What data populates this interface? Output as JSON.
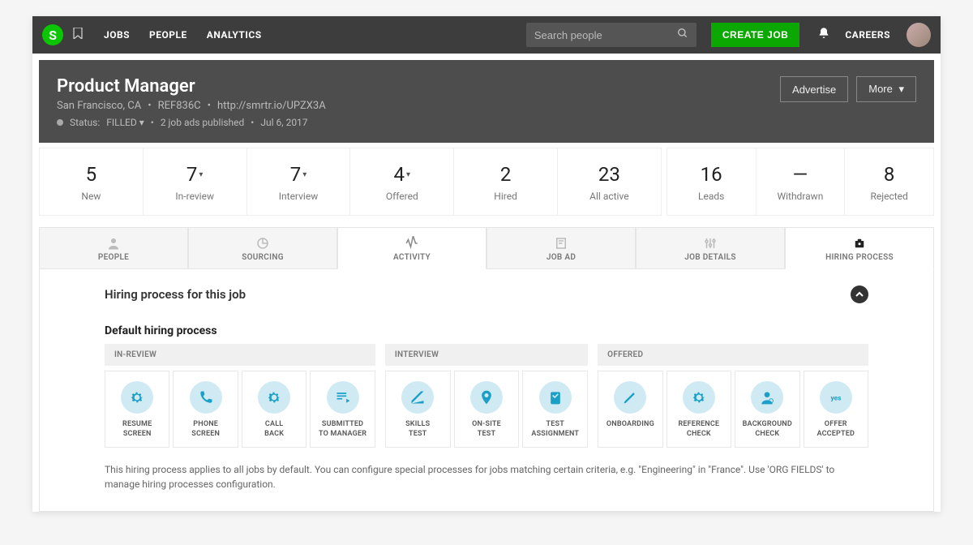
{
  "nav": {
    "logo_letter": "S",
    "links": [
      "JOBS",
      "PEOPLE",
      "ANALYTICS"
    ],
    "search_placeholder": "Search people",
    "create_job": "CREATE JOB",
    "careers": "CAREERS"
  },
  "header": {
    "title": "Product Manager",
    "location": "San Francisco, CA",
    "ref": "REF836C",
    "url": "http://smrtr.io/UPZX3A",
    "status_label": "Status:",
    "status_value": "FILLED",
    "ads": "2 job ads published",
    "date": "Jul 6, 2017",
    "advertise": "Advertise",
    "more": "More"
  },
  "stats": {
    "group1": [
      {
        "value": "5",
        "label": "New",
        "dropdown": false
      },
      {
        "value": "7",
        "label": "In-review",
        "dropdown": true
      },
      {
        "value": "7",
        "label": "Interview",
        "dropdown": true
      },
      {
        "value": "4",
        "label": "Offered",
        "dropdown": true
      },
      {
        "value": "2",
        "label": "Hired",
        "dropdown": false
      },
      {
        "value": "23",
        "label": "All active",
        "dropdown": false
      }
    ],
    "group2": [
      {
        "value": "16",
        "label": "Leads",
        "dropdown": false
      },
      {
        "value": "—",
        "label": "Withdrawn",
        "dropdown": false
      },
      {
        "value": "8",
        "label": "Rejected",
        "dropdown": false
      }
    ]
  },
  "tabs": [
    {
      "label": "PEOPLE"
    },
    {
      "label": "SOURCING"
    },
    {
      "label": "ACTIVITY"
    },
    {
      "label": "JOB AD"
    },
    {
      "label": "JOB DETAILS"
    },
    {
      "label": "HIRING PROCESS"
    }
  ],
  "process": {
    "section_title": "Hiring process for this job",
    "subheading": "Default hiring process",
    "stages": {
      "in_review": {
        "header": "IN-REVIEW",
        "cards": [
          "RESUME SCREEN",
          "PHONE SCREEN",
          "CALL BACK",
          "SUBMITTED TO MANAGER"
        ]
      },
      "interview": {
        "header": "INTERVIEW",
        "cards": [
          "SKILLS TEST",
          "ON-SITE TEST",
          "TEST ASSIGNMENT"
        ]
      },
      "offered": {
        "header": "OFFERED",
        "cards": [
          "ONBOARDING",
          "REFERENCE CHECK",
          "BACKGROUND CHECK",
          "OFFER ACCEPTED"
        ]
      }
    },
    "footnote": "This hiring process applies to all jobs by default. You can configure special processes for jobs matching certain criteria, e.g. \"Engineering\" in \"France\". Use 'ORG FIELDS' to manage hiring processes configuration."
  }
}
